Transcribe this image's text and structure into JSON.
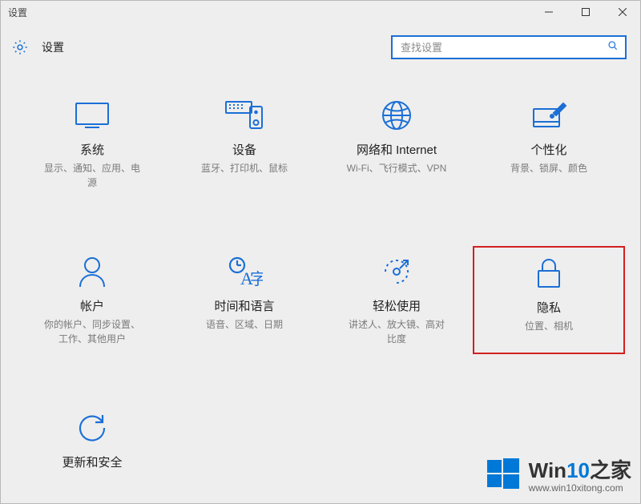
{
  "window": {
    "title": "设置"
  },
  "header": {
    "label": "设置"
  },
  "search": {
    "placeholder": "查找设置"
  },
  "tiles": {
    "system": {
      "title": "系统",
      "sub": "显示、通知、应用、电\n源"
    },
    "devices": {
      "title": "设备",
      "sub": "蓝牙、打印机、鼠标"
    },
    "network": {
      "title": "网络和 Internet",
      "sub": "Wi-Fi、飞行模式、VPN"
    },
    "personal": {
      "title": "个性化",
      "sub": "背景、锁屏、颜色"
    },
    "accounts": {
      "title": "帐户",
      "sub": "你的帐户、同步设置、\n工作、其他用户"
    },
    "timelang": {
      "title": "时间和语言",
      "sub": "语音、区域、日期"
    },
    "ease": {
      "title": "轻松使用",
      "sub": "讲述人、放大镜、高对\n比度"
    },
    "privacy": {
      "title": "隐私",
      "sub": "位置、相机"
    },
    "update": {
      "title": "更新和安全",
      "sub": ""
    }
  },
  "watermark": {
    "brand_prefix": "Win",
    "brand_accent": "10",
    "brand_suffix": "之家",
    "url": "www.win10xitong.com"
  }
}
